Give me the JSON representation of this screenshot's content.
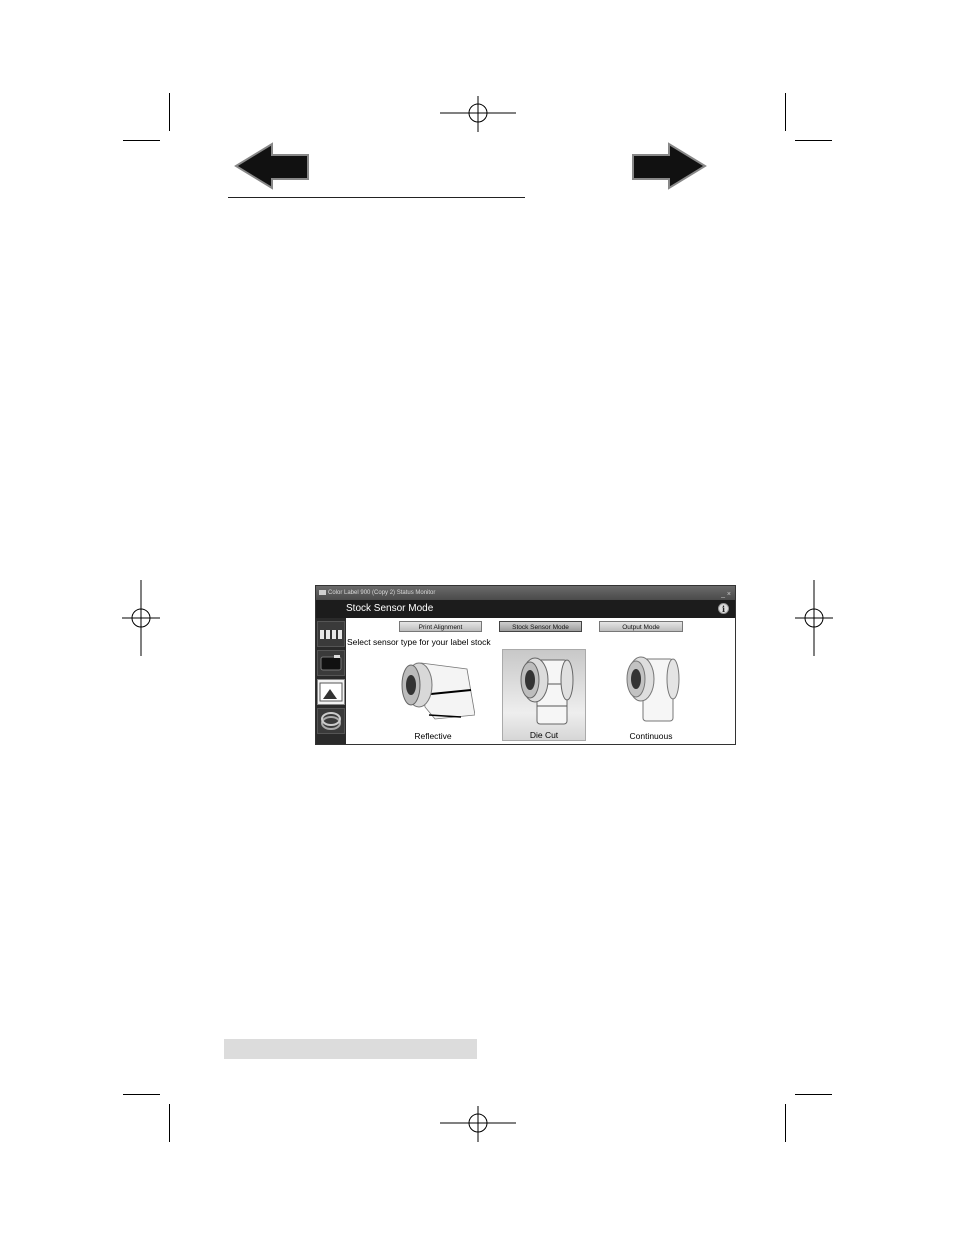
{
  "page": {
    "icons": {
      "back": "left-arrow-icon",
      "forward": "right-arrow-icon",
      "registration": "registration-mark-icon"
    }
  },
  "window": {
    "title": "Color Label 900 (Copy 2) Status Monitor",
    "window_controls": "_ ×",
    "header_title": "Stock Sensor Mode",
    "info_icon_glyph": "i",
    "sidebar_items": [
      {
        "icon": "print-alignment-icon"
      },
      {
        "icon": "cartridge-icon"
      },
      {
        "icon": "stock-sensor-icon",
        "active": true
      },
      {
        "icon": "output-roll-icon"
      }
    ],
    "tabs": [
      {
        "label": "Print Alignment",
        "active": false
      },
      {
        "label": "Stock Sensor Mode",
        "active": true
      },
      {
        "label": "Output Mode",
        "active": false
      }
    ],
    "prompt": "Select sensor type for your label stock",
    "options": [
      {
        "label": "Reflective",
        "icon": "reflective-roll-icon",
        "selected": false
      },
      {
        "label": "Die Cut",
        "icon": "die-cut-roll-icon",
        "selected": true
      },
      {
        "label": "Continuous",
        "icon": "continuous-roll-icon",
        "selected": false
      }
    ]
  }
}
